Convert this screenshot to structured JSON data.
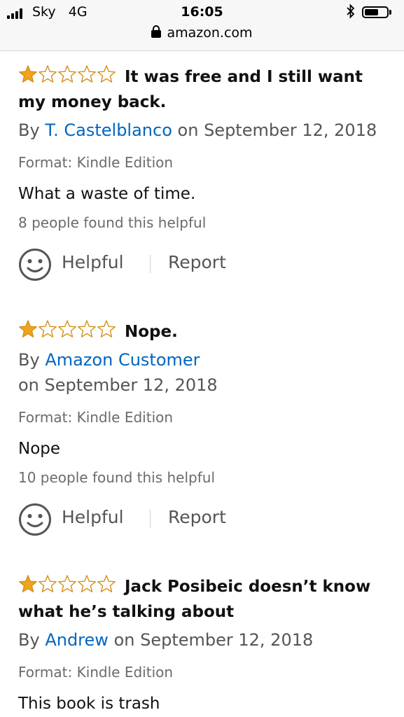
{
  "status_bar": {
    "carrier": "Sky",
    "network": "4G",
    "time": "16:05",
    "url": "amazon.com",
    "bluetooth_icon": "bluetooth-icon",
    "battery_icon": "battery-icon"
  },
  "reviews": [
    {
      "rating": 1,
      "max_rating": 5,
      "title": "It was free and I still want my money back.",
      "by_label": "By",
      "author": "T. Castelblanco",
      "date": "on September 12, 2018",
      "format": "Format: Kindle Edition",
      "body": "What a waste of time.",
      "helpful_count": "8 people found this helpful",
      "helpful_label": "Helpful",
      "report_label": "Report"
    },
    {
      "rating": 1,
      "max_rating": 5,
      "title": "Nope.",
      "by_label": "By",
      "author": "Amazon Customer",
      "date": "on September 12, 2018",
      "format": "Format: Kindle Edition",
      "body": "Nope",
      "helpful_count": "10 people found this helpful",
      "helpful_label": "Helpful",
      "report_label": "Report"
    },
    {
      "rating": 1,
      "max_rating": 5,
      "title": "Jack Posibeic doesn’t know what he’s talking about",
      "by_label": "By",
      "author": "Andrew",
      "date": "on September 12, 2018",
      "format": "Format: Kindle Edition",
      "body": "This book is trash"
    }
  ],
  "colors": {
    "star_fill": "#f0a41c",
    "star_outline": "#d48f17",
    "link": "#0066c0"
  }
}
